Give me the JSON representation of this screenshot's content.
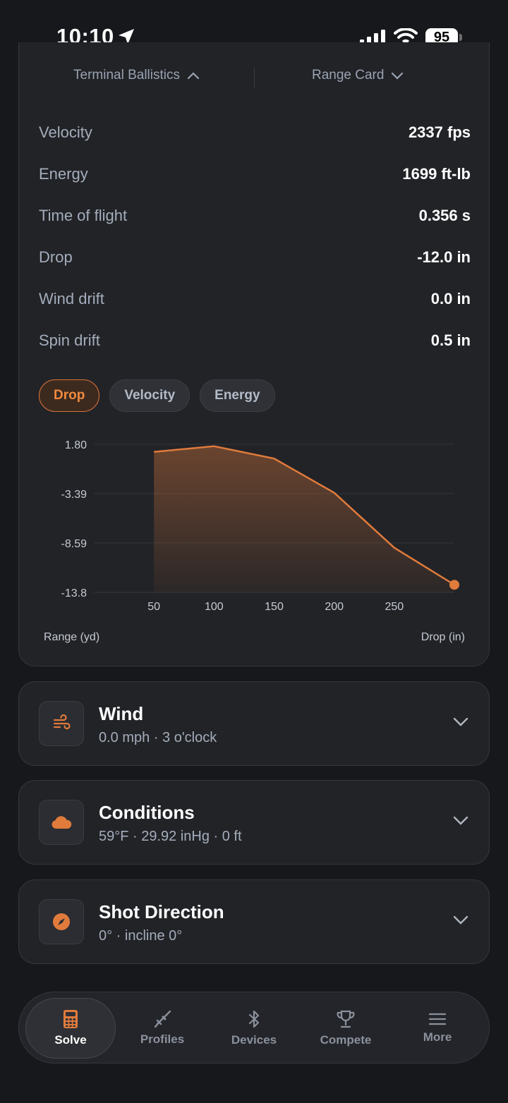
{
  "status_bar": {
    "time": "10:10",
    "battery": "95"
  },
  "toggles": {
    "left_label": "Terminal Ballistics",
    "right_label": "Range Card"
  },
  "stats": [
    {
      "label": "Velocity",
      "value": "2337 fps"
    },
    {
      "label": "Energy",
      "value": "1699 ft-lb"
    },
    {
      "label": "Time of flight",
      "value": "0.356 s"
    },
    {
      "label": "Drop",
      "value": "-12.0 in"
    },
    {
      "label": "Wind drift",
      "value": "0.0 in"
    },
    {
      "label": "Spin drift",
      "value": "0.5 in"
    }
  ],
  "chips": [
    {
      "label": "Drop",
      "active": true
    },
    {
      "label": "Velocity",
      "active": false
    },
    {
      "label": "Energy",
      "active": false
    }
  ],
  "chart_data": {
    "type": "area",
    "x": [
      50,
      100,
      150,
      200,
      250,
      300
    ],
    "series": [
      {
        "values": [
          1.0,
          1.6,
          0.3,
          -3.3,
          -9.1,
          -13.0
        ]
      }
    ],
    "xlabel": "Range (yd)",
    "ylabel": "Drop (in)",
    "x_ticks": [
      "50",
      "100",
      "150",
      "200",
      "250"
    ],
    "y_ticks": [
      "1.80",
      "-3.39",
      "-8.59",
      "-13.8"
    ],
    "ylim": [
      -13.8,
      1.8
    ],
    "xlim": [
      50,
      300
    ],
    "grid": true,
    "color": "#e07b3c"
  },
  "cards": [
    {
      "title": "Wind",
      "subtitle": "0.0 mph · 3 o'clock",
      "icon": "wind-icon"
    },
    {
      "title": "Conditions",
      "subtitle": "59°F · 29.92 inHg · 0 ft",
      "icon": "cloud-icon"
    },
    {
      "title": "Shot Direction",
      "subtitle": "0° · incline 0°",
      "icon": "compass-icon"
    }
  ],
  "tabs": [
    {
      "label": "Solve",
      "icon": "calculator-icon",
      "active": true
    },
    {
      "label": "Profiles",
      "icon": "rifle-icon",
      "active": false
    },
    {
      "label": "Devices",
      "icon": "bluetooth-icon",
      "active": false
    },
    {
      "label": "Compete",
      "icon": "trophy-icon",
      "active": false
    },
    {
      "label": "More",
      "icon": "menu-icon",
      "active": false
    }
  ],
  "colors": {
    "accent": "#e07b3c",
    "background": "#17181b",
    "card": "#222327"
  }
}
